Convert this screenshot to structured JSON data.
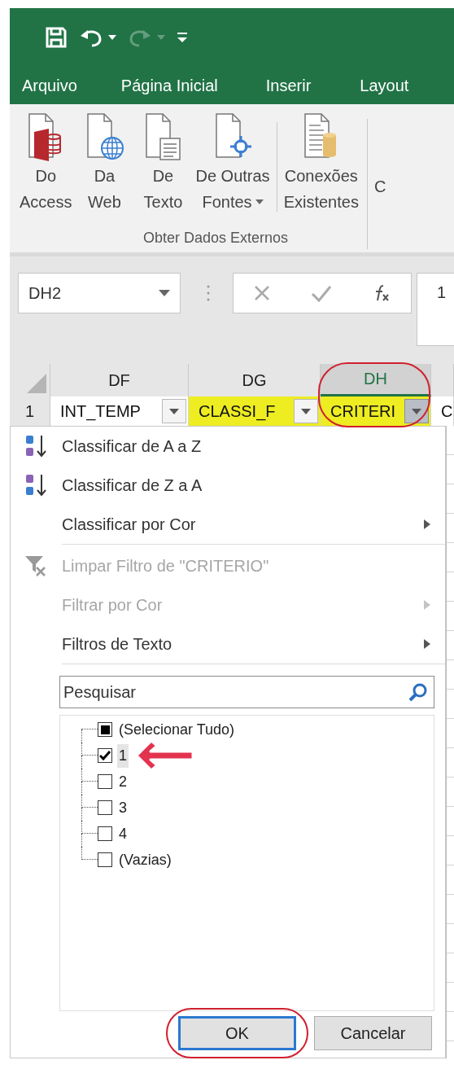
{
  "quick_access": [
    {
      "kind": "save",
      "disabled": false,
      "has_menu": false
    },
    {
      "kind": "undo",
      "disabled": false,
      "has_menu": true
    },
    {
      "kind": "redo",
      "disabled": true,
      "has_menu": true
    },
    {
      "kind": "customize",
      "disabled": false,
      "has_menu": false
    }
  ],
  "ribbon_tabs": [
    {
      "label": "Arquivo"
    },
    {
      "label": "Página Inicial"
    },
    {
      "label": "Inserir"
    },
    {
      "label": "Layout"
    }
  ],
  "ribbon": {
    "group_label": "Obter Dados Externos",
    "sections": [
      [
        {
          "kind": "access",
          "lines": [
            "Do",
            "Access"
          ],
          "has_menu": false
        },
        {
          "kind": "web",
          "lines": [
            "Da",
            "Web"
          ],
          "has_menu": false
        },
        {
          "kind": "text",
          "lines": [
            "De",
            "Texto"
          ],
          "has_menu": false
        },
        {
          "kind": "other",
          "lines": [
            "De Outras",
            "Fontes"
          ],
          "has_menu": true
        }
      ],
      [
        {
          "kind": "connections",
          "lines": [
            "Conexões",
            "Existentes"
          ],
          "has_menu": false
        }
      ]
    ],
    "next_group_label": "C"
  },
  "name_box": {
    "value": "DH2"
  },
  "formula_bar": {
    "value": "1"
  },
  "columns": [
    {
      "label": "DF",
      "selected": false
    },
    {
      "label": "DG",
      "selected": false
    },
    {
      "label": "DH",
      "selected": true,
      "circled": true
    }
  ],
  "rows": [
    {
      "number": "1",
      "cells": [
        {
          "text": "INT_TEMP",
          "highlighted": false,
          "has_filter": true,
          "filter_open": false
        },
        {
          "text": "CLASSI_F",
          "highlighted": true,
          "has_filter": true,
          "filter_open": false
        },
        {
          "text": "CRITERI",
          "highlighted": true,
          "has_filter": true,
          "filter_open": true
        },
        {
          "text": "C",
          "highlighted": false,
          "has_filter": false
        }
      ]
    }
  ],
  "filter_menu": {
    "sections": [
      [
        {
          "kind": "sort_az",
          "label": "Classificar de A a Z",
          "disabled": false,
          "submenu": false
        },
        {
          "kind": "sort_za",
          "label": "Classificar de Z a A",
          "disabled": false,
          "submenu": false
        },
        {
          "kind": "plain",
          "label": "Classificar por Cor",
          "disabled": false,
          "submenu": true
        }
      ],
      [
        {
          "kind": "clear_filter",
          "label": "Limpar Filtro de \"CRITERIO\"",
          "disabled": true,
          "submenu": false
        },
        {
          "kind": "plain",
          "label": "Filtrar por Cor",
          "disabled": true,
          "submenu": true
        },
        {
          "kind": "plain",
          "label": "Filtros de Texto",
          "disabled": false,
          "submenu": true
        }
      ]
    ],
    "search": {
      "placeholder": "Pesquisar"
    },
    "values": [
      {
        "label": "(Selecionar Tudo)",
        "checked": false,
        "partial": true,
        "selected": false
      },
      {
        "label": "1",
        "checked": true,
        "selected": true,
        "pointed": true
      },
      {
        "label": "2",
        "checked": false,
        "selected": false
      },
      {
        "label": "3",
        "checked": false,
        "selected": false
      },
      {
        "label": "4",
        "checked": false,
        "selected": false
      },
      {
        "label": "(Vazias)",
        "checked": false,
        "selected": false
      }
    ],
    "buttons": [
      {
        "label": "OK",
        "default": true,
        "circled": true
      },
      {
        "label": "Cancelar",
        "default": false
      }
    ]
  }
}
